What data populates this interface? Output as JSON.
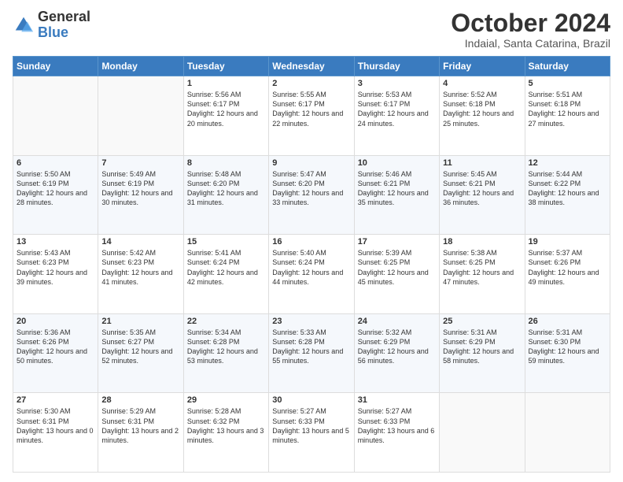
{
  "header": {
    "logo_general": "General",
    "logo_blue": "Blue",
    "month_title": "October 2024",
    "subtitle": "Indaial, Santa Catarina, Brazil"
  },
  "days_of_week": [
    "Sunday",
    "Monday",
    "Tuesday",
    "Wednesday",
    "Thursday",
    "Friday",
    "Saturday"
  ],
  "weeks": [
    [
      {
        "day": "",
        "info": ""
      },
      {
        "day": "",
        "info": ""
      },
      {
        "day": "1",
        "info": "Sunrise: 5:56 AM\nSunset: 6:17 PM\nDaylight: 12 hours and 20 minutes."
      },
      {
        "day": "2",
        "info": "Sunrise: 5:55 AM\nSunset: 6:17 PM\nDaylight: 12 hours and 22 minutes."
      },
      {
        "day": "3",
        "info": "Sunrise: 5:53 AM\nSunset: 6:17 PM\nDaylight: 12 hours and 24 minutes."
      },
      {
        "day": "4",
        "info": "Sunrise: 5:52 AM\nSunset: 6:18 PM\nDaylight: 12 hours and 25 minutes."
      },
      {
        "day": "5",
        "info": "Sunrise: 5:51 AM\nSunset: 6:18 PM\nDaylight: 12 hours and 27 minutes."
      }
    ],
    [
      {
        "day": "6",
        "info": "Sunrise: 5:50 AM\nSunset: 6:19 PM\nDaylight: 12 hours and 28 minutes."
      },
      {
        "day": "7",
        "info": "Sunrise: 5:49 AM\nSunset: 6:19 PM\nDaylight: 12 hours and 30 minutes."
      },
      {
        "day": "8",
        "info": "Sunrise: 5:48 AM\nSunset: 6:20 PM\nDaylight: 12 hours and 31 minutes."
      },
      {
        "day": "9",
        "info": "Sunrise: 5:47 AM\nSunset: 6:20 PM\nDaylight: 12 hours and 33 minutes."
      },
      {
        "day": "10",
        "info": "Sunrise: 5:46 AM\nSunset: 6:21 PM\nDaylight: 12 hours and 35 minutes."
      },
      {
        "day": "11",
        "info": "Sunrise: 5:45 AM\nSunset: 6:21 PM\nDaylight: 12 hours and 36 minutes."
      },
      {
        "day": "12",
        "info": "Sunrise: 5:44 AM\nSunset: 6:22 PM\nDaylight: 12 hours and 38 minutes."
      }
    ],
    [
      {
        "day": "13",
        "info": "Sunrise: 5:43 AM\nSunset: 6:23 PM\nDaylight: 12 hours and 39 minutes."
      },
      {
        "day": "14",
        "info": "Sunrise: 5:42 AM\nSunset: 6:23 PM\nDaylight: 12 hours and 41 minutes."
      },
      {
        "day": "15",
        "info": "Sunrise: 5:41 AM\nSunset: 6:24 PM\nDaylight: 12 hours and 42 minutes."
      },
      {
        "day": "16",
        "info": "Sunrise: 5:40 AM\nSunset: 6:24 PM\nDaylight: 12 hours and 44 minutes."
      },
      {
        "day": "17",
        "info": "Sunrise: 5:39 AM\nSunset: 6:25 PM\nDaylight: 12 hours and 45 minutes."
      },
      {
        "day": "18",
        "info": "Sunrise: 5:38 AM\nSunset: 6:25 PM\nDaylight: 12 hours and 47 minutes."
      },
      {
        "day": "19",
        "info": "Sunrise: 5:37 AM\nSunset: 6:26 PM\nDaylight: 12 hours and 49 minutes."
      }
    ],
    [
      {
        "day": "20",
        "info": "Sunrise: 5:36 AM\nSunset: 6:26 PM\nDaylight: 12 hours and 50 minutes."
      },
      {
        "day": "21",
        "info": "Sunrise: 5:35 AM\nSunset: 6:27 PM\nDaylight: 12 hours and 52 minutes."
      },
      {
        "day": "22",
        "info": "Sunrise: 5:34 AM\nSunset: 6:28 PM\nDaylight: 12 hours and 53 minutes."
      },
      {
        "day": "23",
        "info": "Sunrise: 5:33 AM\nSunset: 6:28 PM\nDaylight: 12 hours and 55 minutes."
      },
      {
        "day": "24",
        "info": "Sunrise: 5:32 AM\nSunset: 6:29 PM\nDaylight: 12 hours and 56 minutes."
      },
      {
        "day": "25",
        "info": "Sunrise: 5:31 AM\nSunset: 6:29 PM\nDaylight: 12 hours and 58 minutes."
      },
      {
        "day": "26",
        "info": "Sunrise: 5:31 AM\nSunset: 6:30 PM\nDaylight: 12 hours and 59 minutes."
      }
    ],
    [
      {
        "day": "27",
        "info": "Sunrise: 5:30 AM\nSunset: 6:31 PM\nDaylight: 13 hours and 0 minutes."
      },
      {
        "day": "28",
        "info": "Sunrise: 5:29 AM\nSunset: 6:31 PM\nDaylight: 13 hours and 2 minutes."
      },
      {
        "day": "29",
        "info": "Sunrise: 5:28 AM\nSunset: 6:32 PM\nDaylight: 13 hours and 3 minutes."
      },
      {
        "day": "30",
        "info": "Sunrise: 5:27 AM\nSunset: 6:33 PM\nDaylight: 13 hours and 5 minutes."
      },
      {
        "day": "31",
        "info": "Sunrise: 5:27 AM\nSunset: 6:33 PM\nDaylight: 13 hours and 6 minutes."
      },
      {
        "day": "",
        "info": ""
      },
      {
        "day": "",
        "info": ""
      }
    ]
  ]
}
